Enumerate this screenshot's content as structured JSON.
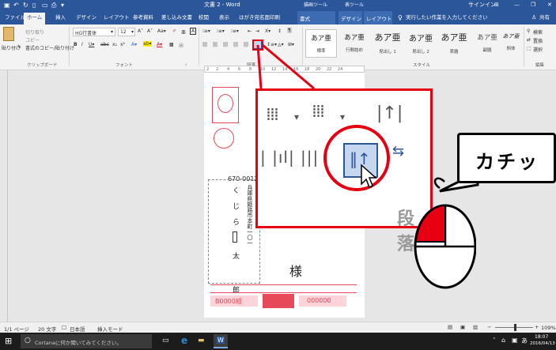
{
  "window": {
    "doc_title": "文書 2 - Word",
    "context_tool_1": "描画ツール",
    "context_tool_2": "表ツール",
    "signin": "サインイン"
  },
  "tabs": [
    "ファイル",
    "ホーム",
    "挿入",
    "デザイン",
    "レイアウト",
    "参考資料",
    "差し込み文書",
    "校閲",
    "表示",
    "はがき宛名面印刷",
    "書式",
    "デザイン",
    "レイアウト"
  ],
  "active_tab": "ホーム",
  "tell_me": "実行したい作業を入力してください",
  "share": "共有",
  "clipboard": {
    "cut": "切り取り",
    "copy": "コピー",
    "paste": "貼り付け",
    "format_painter": "書式のコピー/貼り付け",
    "label": "クリップボード"
  },
  "font": {
    "name": "HG行書体",
    "size": "12",
    "label": "フォント"
  },
  "paragraph_label": "段落",
  "styles": {
    "items": [
      {
        "sample": "あア亜",
        "name": "標準"
      },
      {
        "sample": "あア亜",
        "name": "行間詰め"
      },
      {
        "sample": "あア亜",
        "name": "見出し 1"
      },
      {
        "sample": "あア亜",
        "name": "見出し 2"
      },
      {
        "sample": "あア亜",
        "name": "表題"
      },
      {
        "sample": "あア亜",
        "name": "副題"
      },
      {
        "sample": "あア亜",
        "name": "斜体"
      }
    ],
    "label": "スタイル"
  },
  "editing": {
    "find": "検索",
    "replace": "置換",
    "select": "選択",
    "label": "編集"
  },
  "ruler_ticks": [
    "2",
    "2",
    "4",
    "6",
    "8",
    "10",
    "12",
    "14",
    "16",
    "18",
    "20",
    "22",
    "24"
  ],
  "postcard": {
    "postal_code": "670-0012",
    "address": "兵庫県姫路市本町一〇一",
    "name_chars": [
      "く",
      "じ",
      "ら",
      "太",
      "郎"
    ],
    "honorific": "様",
    "lottery_left": "B0000組",
    "lottery_right": "000000"
  },
  "callout_zoom_label": "段落",
  "bubble_text": "カチッ",
  "status": {
    "page": "1/1 ページ",
    "words": "20 文字",
    "lang": "日本語",
    "mode": "挿入モード",
    "zoom": "109%"
  },
  "taskbar": {
    "search": "Cortanaに何か聞いてみてください。",
    "time": "18:07",
    "date": "2016/04/13",
    "ime": "あ"
  },
  "colors": {
    "word_blue": "#2b579a",
    "highlight_red": "#e60012",
    "stamp_red": "#e8495a"
  }
}
